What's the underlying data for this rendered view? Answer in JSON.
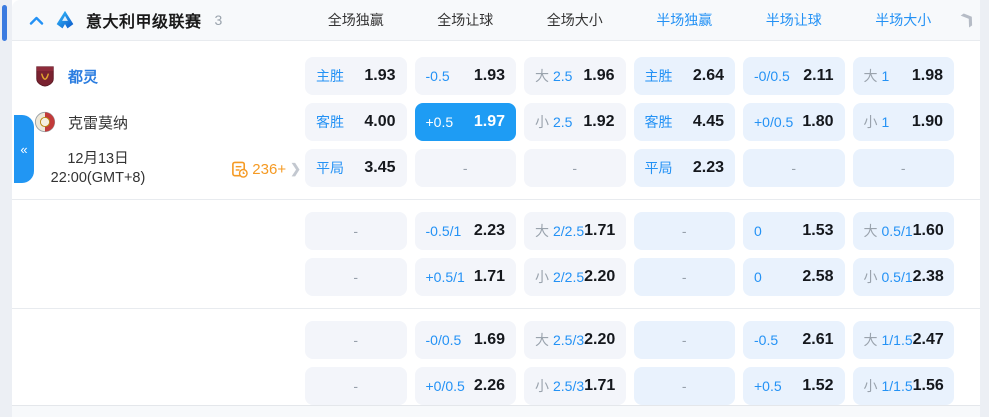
{
  "colors": {
    "accent": "#2492f5",
    "selected_bg": "#1e9cf4",
    "full_cell_bg": "#f3f5fa",
    "half_cell_bg": "#e9f2fd",
    "header_bg": "#f7f9fb",
    "orange": "#f59a23",
    "home_team_color": "#2b7de0"
  },
  "header": {
    "league": "意大利甲级联赛",
    "count": "3",
    "columns": [
      {
        "label": "全场独赢",
        "period": "full"
      },
      {
        "label": "全场让球",
        "period": "full"
      },
      {
        "label": "全场大小",
        "period": "full"
      },
      {
        "label": "半场独赢",
        "period": "half"
      },
      {
        "label": "半场让球",
        "period": "half"
      },
      {
        "label": "半场大小",
        "period": "half"
      }
    ]
  },
  "match": {
    "home": "都灵",
    "away": "克雷莫纳",
    "date": "12月13日",
    "time": "22:00(GMT+8)",
    "markets_count": "236+"
  },
  "misc": {
    "dash": "-",
    "collapse_glyph": "«",
    "more_glyph": "❯"
  },
  "odds_groups": [
    {
      "rows": [
        {
          "cells": [
            {
              "type": "named",
              "label": "主胜",
              "odds": "1.93"
            },
            {
              "type": "hcp",
              "label": "-0.5",
              "odds": "1.93"
            },
            {
              "type": "ou",
              "side": "大",
              "line": "2.5",
              "odds": "1.96"
            },
            {
              "type": "named",
              "label": "主胜",
              "odds": "2.64"
            },
            {
              "type": "hcp",
              "label": "-0/0.5",
              "odds": "2.11"
            },
            {
              "type": "ou",
              "side": "大",
              "line": "1",
              "odds": "1.98"
            }
          ]
        },
        {
          "cells": [
            {
              "type": "named",
              "label": "客胜",
              "odds": "4.00"
            },
            {
              "type": "hcp",
              "label": "+0.5",
              "odds": "1.97",
              "selected": true
            },
            {
              "type": "ou",
              "side": "小",
              "line": "2.5",
              "odds": "1.92"
            },
            {
              "type": "named",
              "label": "客胜",
              "odds": "4.45"
            },
            {
              "type": "hcp",
              "label": "+0/0.5",
              "odds": "1.80"
            },
            {
              "type": "ou",
              "side": "小",
              "line": "1",
              "odds": "1.90"
            }
          ]
        },
        {
          "cells": [
            {
              "type": "named",
              "label": "平局",
              "odds": "3.45"
            },
            {
              "type": "dash"
            },
            {
              "type": "dash"
            },
            {
              "type": "named",
              "label": "平局",
              "odds": "2.23"
            },
            {
              "type": "dash"
            },
            {
              "type": "dash"
            }
          ]
        }
      ]
    },
    {
      "rows": [
        {
          "cells": [
            {
              "type": "dash"
            },
            {
              "type": "hcp",
              "label": "-0.5/1",
              "odds": "2.23"
            },
            {
              "type": "ou",
              "side": "大",
              "line": "2/2.5",
              "odds": "1.71"
            },
            {
              "type": "dash"
            },
            {
              "type": "hcp",
              "label": "0",
              "odds": "1.53"
            },
            {
              "type": "ou",
              "side": "大",
              "line": "0.5/1",
              "odds": "1.60"
            }
          ]
        },
        {
          "cells": [
            {
              "type": "dash"
            },
            {
              "type": "hcp",
              "label": "+0.5/1",
              "odds": "1.71"
            },
            {
              "type": "ou",
              "side": "小",
              "line": "2/2.5",
              "odds": "2.20"
            },
            {
              "type": "dash"
            },
            {
              "type": "hcp",
              "label": "0",
              "odds": "2.58"
            },
            {
              "type": "ou",
              "side": "小",
              "line": "0.5/1",
              "odds": "2.38"
            }
          ]
        }
      ]
    },
    {
      "rows": [
        {
          "cells": [
            {
              "type": "dash"
            },
            {
              "type": "hcp",
              "label": "-0/0.5",
              "odds": "1.69"
            },
            {
              "type": "ou",
              "side": "大",
              "line": "2.5/3",
              "odds": "2.20"
            },
            {
              "type": "dash"
            },
            {
              "type": "hcp",
              "label": "-0.5",
              "odds": "2.61"
            },
            {
              "type": "ou",
              "side": "大",
              "line": "1/1.5",
              "odds": "2.47"
            }
          ]
        },
        {
          "cells": [
            {
              "type": "dash"
            },
            {
              "type": "hcp",
              "label": "+0/0.5",
              "odds": "2.26"
            },
            {
              "type": "ou",
              "side": "小",
              "line": "2.5/3",
              "odds": "1.71"
            },
            {
              "type": "dash"
            },
            {
              "type": "hcp",
              "label": "+0.5",
              "odds": "1.52"
            },
            {
              "type": "ou",
              "side": "小",
              "line": "1/1.5",
              "odds": "1.56"
            }
          ]
        }
      ]
    }
  ]
}
